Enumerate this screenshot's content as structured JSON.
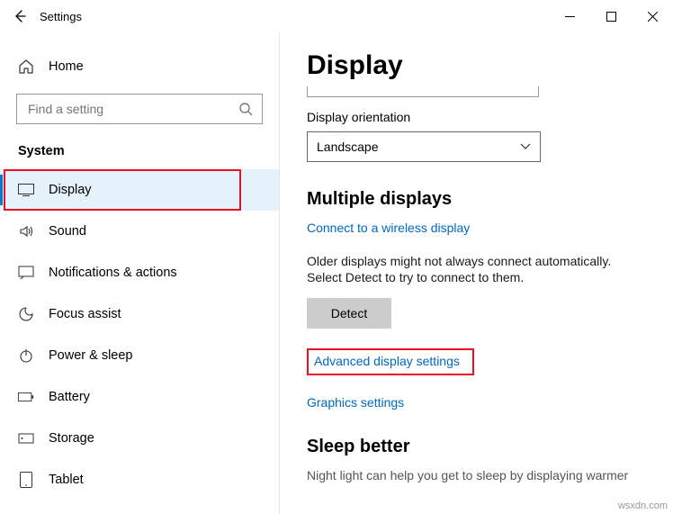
{
  "titlebar": {
    "title": "Settings"
  },
  "sidebar": {
    "home": "Home",
    "search_placeholder": "Find a setting",
    "category": "System",
    "items": [
      {
        "label": "Display"
      },
      {
        "label": "Sound"
      },
      {
        "label": "Notifications & actions"
      },
      {
        "label": "Focus assist"
      },
      {
        "label": "Power & sleep"
      },
      {
        "label": "Battery"
      },
      {
        "label": "Storage"
      },
      {
        "label": "Tablet"
      }
    ]
  },
  "main": {
    "title": "Display",
    "orientation_label": "Display orientation",
    "orientation_value": "Landscape",
    "multi_title": "Multiple displays",
    "wireless_link": "Connect to a wireless display",
    "older_text": "Older displays might not always connect automatically. Select Detect to try to connect to them.",
    "detect": "Detect",
    "advanced_link": "Advanced display settings",
    "graphics_link": "Graphics settings",
    "sleep_title": "Sleep better",
    "sleep_text": "Night light can help you get to sleep by displaying warmer"
  },
  "watermark": "wsxdn.com"
}
